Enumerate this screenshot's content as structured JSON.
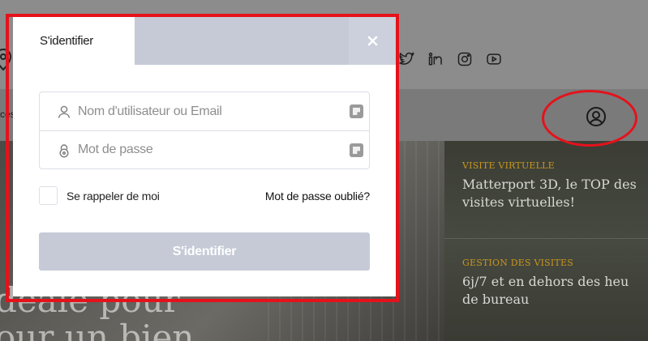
{
  "background": {
    "nav_cut_text": "ces",
    "hero_lines": [
      "déale pour",
      "our un bien"
    ],
    "social_icons": [
      "twitter-icon",
      "linkedin-icon",
      "instagram-icon",
      "youtube-icon"
    ],
    "cards": [
      {
        "category": "VISITE VIRTUELLE",
        "title_line1": "Matterport 3D, le TOP des",
        "title_line2": "visites virtuelles!"
      },
      {
        "category": "GESTION DES VISITES",
        "title_line1": "6j/7 et en dehors des heu",
        "title_line2": "de bureau"
      }
    ]
  },
  "modal": {
    "tab_label": "S'identifier",
    "close_icon": "close-icon",
    "username_placeholder": "Nom d'utilisateur ou Email",
    "password_placeholder": "Mot de passe",
    "remember_label": "Se rappeler de moi",
    "forgot_label": "Mot de passe oublié?",
    "submit_label": "S'identifier"
  },
  "colors": {
    "highlight": "#e5121b",
    "tab_bar": "#c5cad6",
    "submit_button": "#c5cad6",
    "category_gold": "#c8961e"
  }
}
